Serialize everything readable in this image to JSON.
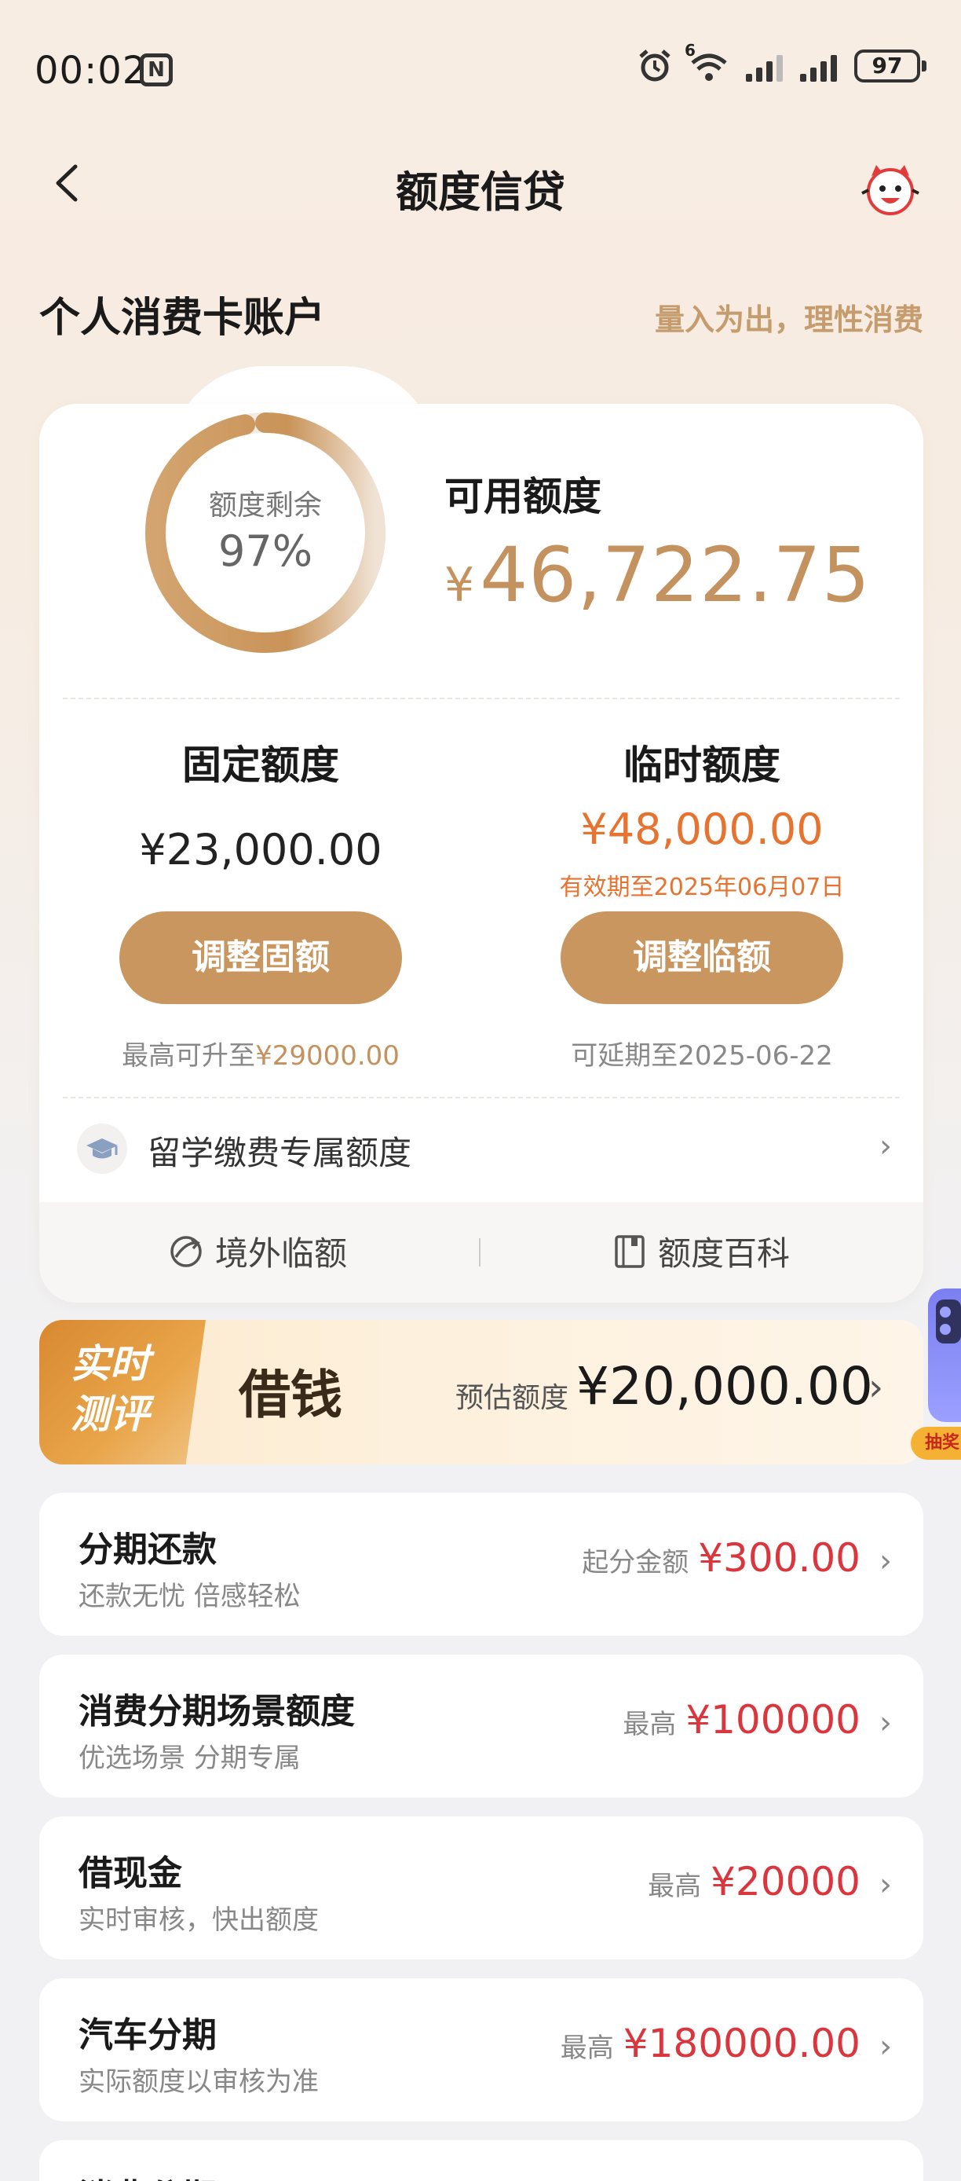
{
  "status_bar": {
    "time": "00:02",
    "nfc": "N",
    "wifi_badge": "6",
    "battery": "97"
  },
  "header": {
    "title": "额度信贷"
  },
  "account": {
    "title": "个人消费卡账户",
    "slogan": "量入为出，理性消费"
  },
  "credit": {
    "ring_label": "额度剩余",
    "ring_percent": "97%",
    "ring_fraction": 0.97,
    "available_label": "可用额度",
    "available_currency": "¥",
    "available_amount": "46,722.75"
  },
  "fixed": {
    "title": "固定额度",
    "amount": "¥23,000.00",
    "button": "调整固额",
    "hint_prefix": "最高可升至",
    "hint_value": "¥29000.00"
  },
  "temporary": {
    "title": "临时额度",
    "amount": "¥48,000.00",
    "validity": "有效期至2025年06月07日",
    "button": "调整临额",
    "hint": "可延期至2025-06-22"
  },
  "study_abroad": {
    "label": "留学缴费专属额度"
  },
  "links": {
    "overseas": "境外临额",
    "encyclopedia": "额度百科"
  },
  "banner": {
    "tag_line1": "实时",
    "tag_line2": "测评",
    "title": "借钱",
    "est_label": "预估额度",
    "est_amount": "¥20,000.00"
  },
  "side_ad": {
    "tag": "抽奖"
  },
  "products": [
    {
      "title": "分期还款",
      "subtitle": "还款无忧 倍感轻松",
      "right_label": "起分金额",
      "right_amount": "¥300.00"
    },
    {
      "title": "消费分期场景额度",
      "subtitle": "优选场景 分期专属",
      "right_label": "最高",
      "right_amount": "¥100000"
    },
    {
      "title": "借现金",
      "subtitle": "实时审核，快出额度",
      "right_label": "最高",
      "right_amount": "¥20000"
    },
    {
      "title": "汽车分期",
      "subtitle": "实际额度以审核为准",
      "right_label": "最高",
      "right_amount": "¥180000.00"
    },
    {
      "title": "消费分期"
    }
  ],
  "colors": {
    "gold": "#c9965f",
    "accent_orange": "#e6732f",
    "price_red": "#d9363e"
  }
}
